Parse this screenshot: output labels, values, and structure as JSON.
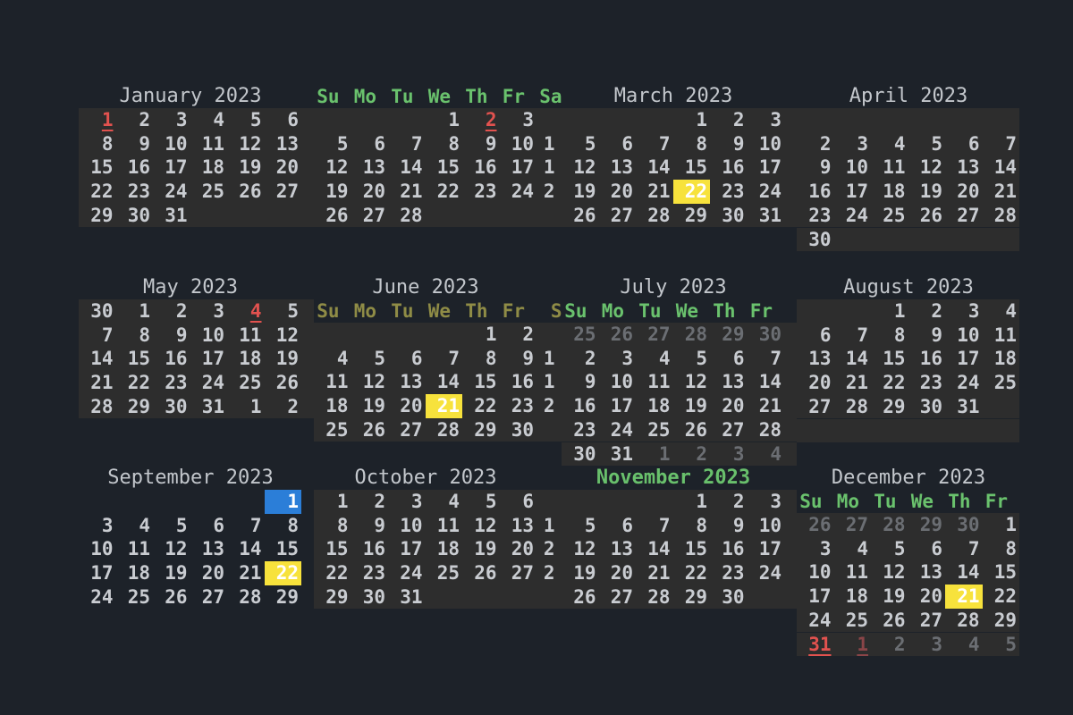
{
  "weekday_headers": [
    "Su",
    "Mo",
    "Tu",
    "We",
    "Th",
    "Fr",
    "Sa"
  ],
  "months": [
    {
      "title": "January 2023",
      "shaded": true,
      "rows": [
        [
          {
            "t": "1",
            "s": "red ul"
          },
          "2",
          "3",
          "4",
          "5",
          "6"
        ],
        [
          "8",
          "9",
          "10",
          "11",
          "12",
          "13"
        ],
        [
          "15",
          "16",
          "17",
          "18",
          "19",
          "20"
        ],
        [
          "22",
          "23",
          "24",
          "25",
          "26",
          "27"
        ],
        [
          "29",
          "30",
          "31"
        ]
      ]
    },
    {
      "title": "",
      "header": [
        "Su",
        "Mo",
        "Tu",
        "We",
        "Th",
        "Fr",
        "Sa"
      ],
      "shaded": true,
      "rows": [
        [
          "",
          "",
          "",
          "1",
          {
            "t": "2",
            "s": "red ul"
          },
          "3"
        ],
        [
          "5",
          "6",
          "7",
          "8",
          "9",
          "10",
          "1"
        ],
        [
          "12",
          "13",
          "14",
          "15",
          "16",
          "17",
          "1"
        ],
        [
          "19",
          "20",
          "21",
          "22",
          "23",
          "24",
          "2"
        ],
        [
          "26",
          "27",
          "28"
        ]
      ]
    },
    {
      "title": "March 2023",
      "shaded": true,
      "rows": [
        [
          "",
          "",
          "",
          "1",
          "2",
          "3"
        ],
        [
          "5",
          "6",
          "7",
          "8",
          "9",
          "10"
        ],
        [
          "12",
          "13",
          "14",
          "15",
          "16",
          "17"
        ],
        [
          "19",
          "20",
          "21",
          {
            "t": "22",
            "s": "today"
          },
          "23",
          "24"
        ],
        [
          "26",
          "27",
          "28",
          "29",
          "30",
          "31"
        ]
      ]
    },
    {
      "title": "April 2023",
      "shaded": true,
      "rows": [
        [],
        [
          "2",
          "3",
          "4",
          "5",
          "6",
          "7"
        ],
        [
          "9",
          "10",
          "11",
          "12",
          "13",
          "14"
        ],
        [
          "16",
          "17",
          "18",
          "19",
          "20",
          "21"
        ],
        [
          "23",
          "24",
          "25",
          "26",
          "27",
          "28"
        ],
        [
          "30"
        ]
      ]
    },
    {
      "title": "May 2023",
      "shaded": true,
      "rows": [
        [
          "30",
          "1",
          "2",
          "3",
          {
            "t": "4",
            "s": "red ul"
          },
          "5"
        ],
        [
          "7",
          "8",
          "9",
          "10",
          "11",
          "12"
        ],
        [
          "14",
          "15",
          "16",
          "17",
          "18",
          "19"
        ],
        [
          "21",
          "22",
          "23",
          "24",
          "25",
          "26"
        ],
        [
          "28",
          "29",
          "30",
          "31",
          "1",
          "2"
        ]
      ]
    },
    {
      "title": "June 2023",
      "header": [
        "Su",
        "Mo",
        "Tu",
        "We",
        "Th",
        "Fr",
        "S"
      ],
      "header_style": "olive",
      "shaded": true,
      "rows": [
        [
          "",
          "",
          "",
          "",
          "1",
          "2"
        ],
        [
          "4",
          "5",
          "6",
          "7",
          "8",
          "9",
          "1"
        ],
        [
          "11",
          "12",
          "13",
          "14",
          "15",
          "16",
          "1"
        ],
        [
          "18",
          "19",
          "20",
          {
            "t": "21",
            "s": "today"
          },
          "22",
          "23",
          "2"
        ],
        [
          "25",
          "26",
          "27",
          "28",
          "29",
          "30"
        ]
      ]
    },
    {
      "title": "July 2023",
      "header": [
        "Su",
        "Mo",
        "Tu",
        "We",
        "Th",
        "Fr"
      ],
      "shaded": true,
      "rows": [
        [
          {
            "t": "25",
            "s": "dim"
          },
          {
            "t": "26",
            "s": "dim"
          },
          {
            "t": "27",
            "s": "dim"
          },
          {
            "t": "28",
            "s": "dim"
          },
          {
            "t": "29",
            "s": "dim"
          },
          {
            "t": "30",
            "s": "dim"
          }
        ],
        [
          "2",
          "3",
          "4",
          "5",
          "6",
          "7"
        ],
        [
          "9",
          "10",
          "11",
          "12",
          "13",
          "14"
        ],
        [
          "16",
          "17",
          "18",
          "19",
          "20",
          "21"
        ],
        [
          "23",
          "24",
          "25",
          "26",
          "27",
          "28"
        ],
        [
          "30",
          "31",
          {
            "t": "1",
            "s": "dim"
          },
          {
            "t": "2",
            "s": "dim"
          },
          {
            "t": "3",
            "s": "dim"
          },
          {
            "t": "4",
            "s": "dim"
          }
        ]
      ]
    },
    {
      "title": "August 2023",
      "shaded": true,
      "rows": [
        [
          "",
          "",
          "1",
          "2",
          "3",
          "4"
        ],
        [
          "6",
          "7",
          "8",
          "9",
          "10",
          "11"
        ],
        [
          "13",
          "14",
          "15",
          "16",
          "17",
          "18"
        ],
        [
          "20",
          "21",
          "22",
          "23",
          "24",
          "25"
        ],
        [
          "27",
          "28",
          "29",
          "30",
          "31"
        ],
        []
      ]
    },
    {
      "title": "September 2023",
      "shaded": false,
      "rows": [
        [
          "",
          "",
          "",
          "",
          "",
          {
            "t": "1",
            "s": "sel"
          }
        ],
        [
          "3",
          "4",
          "5",
          "6",
          "7",
          "8"
        ],
        [
          "10",
          "11",
          "12",
          "13",
          "14",
          "15"
        ],
        [
          "17",
          "18",
          "19",
          "20",
          "21",
          {
            "t": "22",
            "s": "today"
          }
        ],
        [
          "24",
          "25",
          "26",
          "27",
          "28",
          "29"
        ]
      ]
    },
    {
      "title": "October 2023",
      "shaded": true,
      "rows": [
        [
          "1",
          "2",
          "3",
          "4",
          "5",
          "6"
        ],
        [
          "8",
          "9",
          "10",
          "11",
          "12",
          "13",
          "1"
        ],
        [
          "15",
          "16",
          "17",
          "18",
          "19",
          "20",
          "2"
        ],
        [
          "22",
          "23",
          "24",
          "25",
          "26",
          "27",
          "2"
        ],
        [
          "29",
          "30",
          "31"
        ]
      ]
    },
    {
      "title": "November 2023",
      "title_style": "green",
      "shaded": true,
      "rows": [
        [
          "",
          "",
          "",
          "1",
          "2",
          "3"
        ],
        [
          "5",
          "6",
          "7",
          "8",
          "9",
          "10"
        ],
        [
          "12",
          "13",
          "14",
          "15",
          "16",
          "17"
        ],
        [
          "19",
          "20",
          "21",
          "22",
          "23",
          "24"
        ],
        [
          "26",
          "27",
          "28",
          "29",
          "30"
        ]
      ]
    },
    {
      "title": "December 2023",
      "header": [
        "Su",
        "Mo",
        "Tu",
        "We",
        "Th",
        "Fr"
      ],
      "shaded": true,
      "rows": [
        [
          {
            "t": "26",
            "s": "dim"
          },
          {
            "t": "27",
            "s": "dim"
          },
          {
            "t": "28",
            "s": "dim"
          },
          {
            "t": "29",
            "s": "dim"
          },
          {
            "t": "30",
            "s": "dim"
          },
          "1"
        ],
        [
          "3",
          "4",
          "5",
          "6",
          "7",
          "8"
        ],
        [
          "10",
          "11",
          "12",
          "13",
          "14",
          "15"
        ],
        [
          "17",
          "18",
          "19",
          "20",
          {
            "t": "21",
            "s": "today"
          },
          "22"
        ],
        [
          "24",
          "25",
          "26",
          "27",
          "28",
          "29"
        ],
        [
          {
            "t": "31",
            "s": "red ul"
          },
          {
            "t": "1",
            "s": "dimred ul"
          },
          {
            "t": "2",
            "s": "dim"
          },
          {
            "t": "3",
            "s": "dim"
          },
          {
            "t": "4",
            "s": "dim"
          },
          {
            "t": "5",
            "s": "dim"
          }
        ]
      ]
    }
  ],
  "colors": {
    "background": "#1d2229",
    "shade": "#2d2d2d",
    "text": "#c9ccd1",
    "weekday_green": "#6ac26d",
    "weekday_olive": "#8f8c46",
    "holiday_red": "#e2524f",
    "today_yellow": "#f7e23c",
    "selected_blue": "#2b7ed8"
  }
}
